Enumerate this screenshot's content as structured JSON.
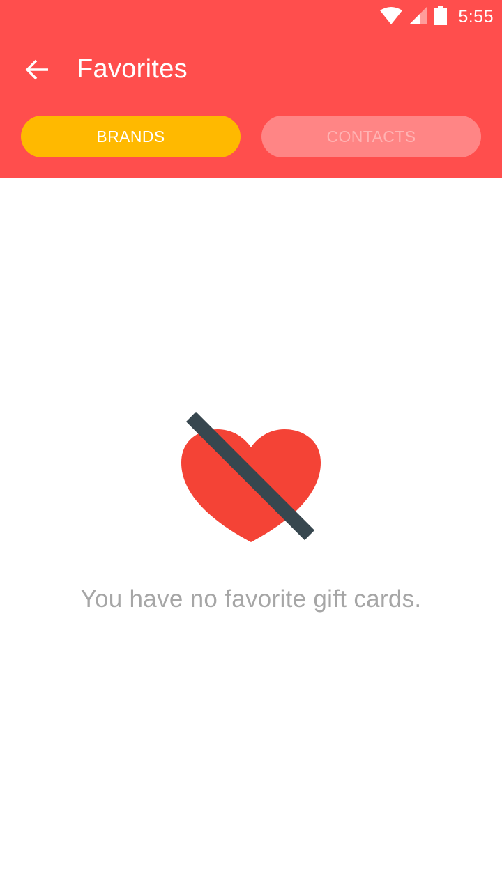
{
  "status_bar": {
    "time": "5:55",
    "icons": [
      "wifi-icon",
      "cell-signal-icon",
      "battery-icon"
    ]
  },
  "toolbar": {
    "title": "Favorites",
    "back_icon": "arrow-back-icon"
  },
  "tabs": [
    {
      "label": "BRANDS",
      "selected": true
    },
    {
      "label": "CONTACTS",
      "selected": false
    }
  ],
  "empty_state": {
    "illustration": "heart-crossed-out-icon",
    "message": "You have no favorite gift cards."
  },
  "colors": {
    "header_background": "#ff4e4d",
    "tab_selected": "#ffb900",
    "tab_unselected": "#ff8585",
    "heart": "#f44336",
    "slash": "#37474f",
    "message_text": "#a6a6a6"
  }
}
